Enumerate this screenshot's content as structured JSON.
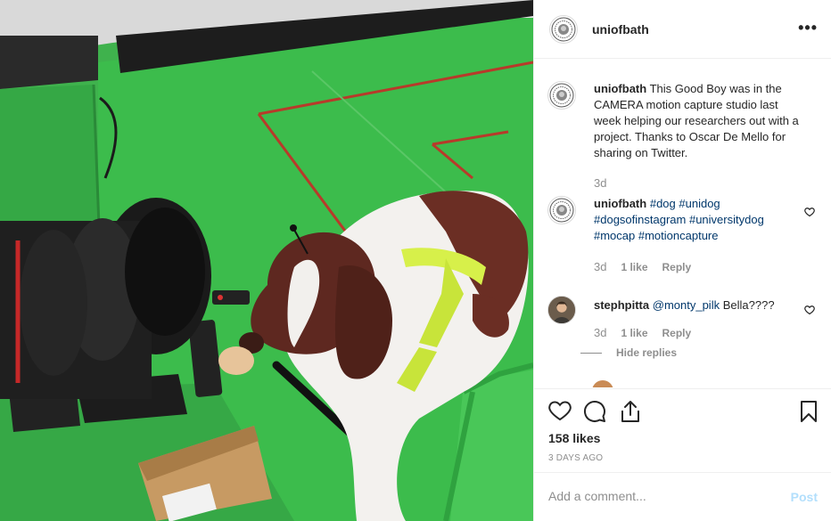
{
  "post": {
    "username": "uniofbath",
    "more_label": "•••"
  },
  "comments": [
    {
      "username": "uniofbath",
      "text": "This Good Boy was in the CAMERA motion capture studio last week helping our researchers out with a project. Thanks to Oscar De Mello for sharing on Twitter.",
      "time": "3d"
    },
    {
      "username": "uniofbath",
      "tags": [
        "#dog",
        "#unidog",
        "#dogsofinstagram",
        "#universitydog",
        "#mocap",
        "#motioncapture"
      ],
      "time": "3d",
      "likes": "1 like",
      "reply": "Reply"
    },
    {
      "username": "stephpitta",
      "mention": "@monty_pilk",
      "text": "Bella????",
      "time": "3d",
      "likes": "1 like",
      "reply": "Reply"
    }
  ],
  "hide_replies": "Hide replies",
  "likes_count": "158 likes",
  "date": "3 DAYS AGO",
  "add_comment": {
    "placeholder": "Add a comment...",
    "post_label": "Post"
  },
  "colors": {
    "studio_green": "#38b74a",
    "link_blue": "#00376b",
    "muted_gray": "#8e8e8e",
    "post_disabled": "#b2dffc"
  },
  "icons": [
    "heart-icon",
    "comment-icon",
    "share-icon",
    "bookmark-icon",
    "more-icon",
    "university-seal-icon"
  ]
}
